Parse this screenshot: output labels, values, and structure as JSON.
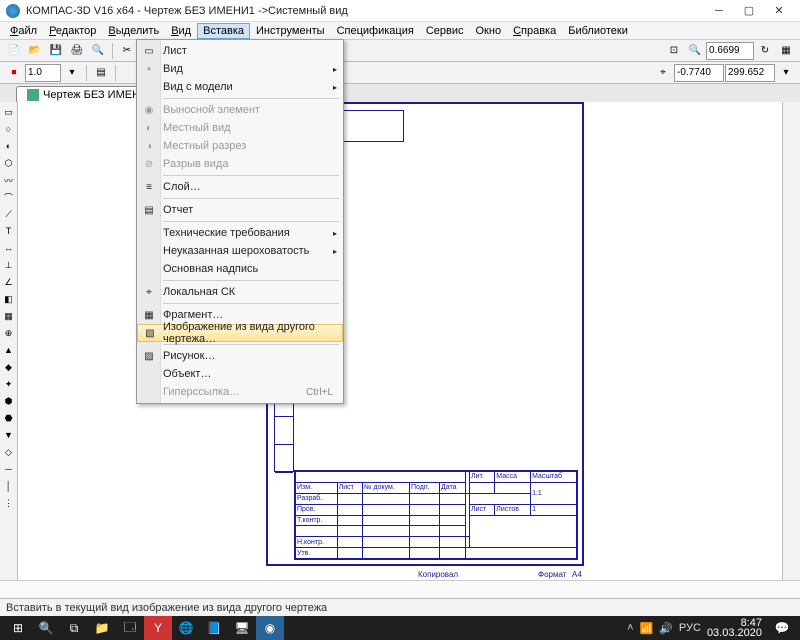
{
  "window": {
    "title": "КОМПАС-3D V16 x64 - Чертеж БЕЗ ИМЕНИ1 ->Системный вид"
  },
  "menubar": [
    "Файл",
    "Редактор",
    "Выделить",
    "Вид",
    "Вставка",
    "Инструменты",
    "Спецификация",
    "Сервис",
    "Окно",
    "Справка",
    "Библиотеки"
  ],
  "active_menu_index": 4,
  "toolbar2": {
    "scale": "1.0",
    "zoom_val": "0.6699",
    "coord_x": "-0.7740",
    "coord_y": "299.652"
  },
  "doc_tab": "Чертеж БЕЗ ИМЕНИ1",
  "dropdown": [
    {
      "label": "Лист",
      "icon": "▭"
    },
    {
      "label": "Вид",
      "icon": "▫",
      "submenu": true
    },
    {
      "label": "Вид с модели",
      "submenu": true
    },
    {
      "sep": true
    },
    {
      "label": "Выносной элемент",
      "disabled": true,
      "icon": "◉"
    },
    {
      "label": "Местный вид",
      "disabled": true,
      "icon": "◐"
    },
    {
      "label": "Местный разрез",
      "disabled": true,
      "icon": "◑"
    },
    {
      "label": "Разрыв вида",
      "disabled": true,
      "icon": "⊘"
    },
    {
      "sep": true
    },
    {
      "label": "Слой…",
      "icon": "≡"
    },
    {
      "sep": true
    },
    {
      "label": "Отчет",
      "icon": "▤"
    },
    {
      "sep": true
    },
    {
      "label": "Технические требования",
      "submenu": true
    },
    {
      "label": "Неуказанная шероховатость",
      "submenu": true
    },
    {
      "label": "Основная надпись"
    },
    {
      "sep": true
    },
    {
      "label": "Локальная СК",
      "icon": "⌖"
    },
    {
      "sep": true
    },
    {
      "label": "Фрагмент…",
      "icon": "▦"
    },
    {
      "label": "Изображение из вида другого чертежа…",
      "highlighted": true,
      "icon": "▧"
    },
    {
      "sep": true
    },
    {
      "label": "Рисунок…",
      "icon": "▨"
    },
    {
      "label": "Объект…"
    },
    {
      "label": "Гиперссылка…",
      "disabled": true,
      "shortcut": "Ctrl+L"
    }
  ],
  "titleblock": {
    "rows": [
      "Изм.",
      "Разраб.",
      "Пров.",
      "Т.контр.",
      "Н.контр.",
      "Утв."
    ],
    "cols2": [
      "Лит.",
      "Масса",
      "Масштаб"
    ],
    "val11": "1:1",
    "sheet": "Лист",
    "sheets": "Листов",
    "sheetn": "1"
  },
  "bottom_labels": {
    "copied": "Копировал",
    "format": "Формат",
    "fmt": "A4"
  },
  "status": "Вставить в текущий вид изображение из вида другого чертежа",
  "taskbar": {
    "time": "8:47",
    "date": "03.03.2020",
    "lang": "РУС"
  }
}
